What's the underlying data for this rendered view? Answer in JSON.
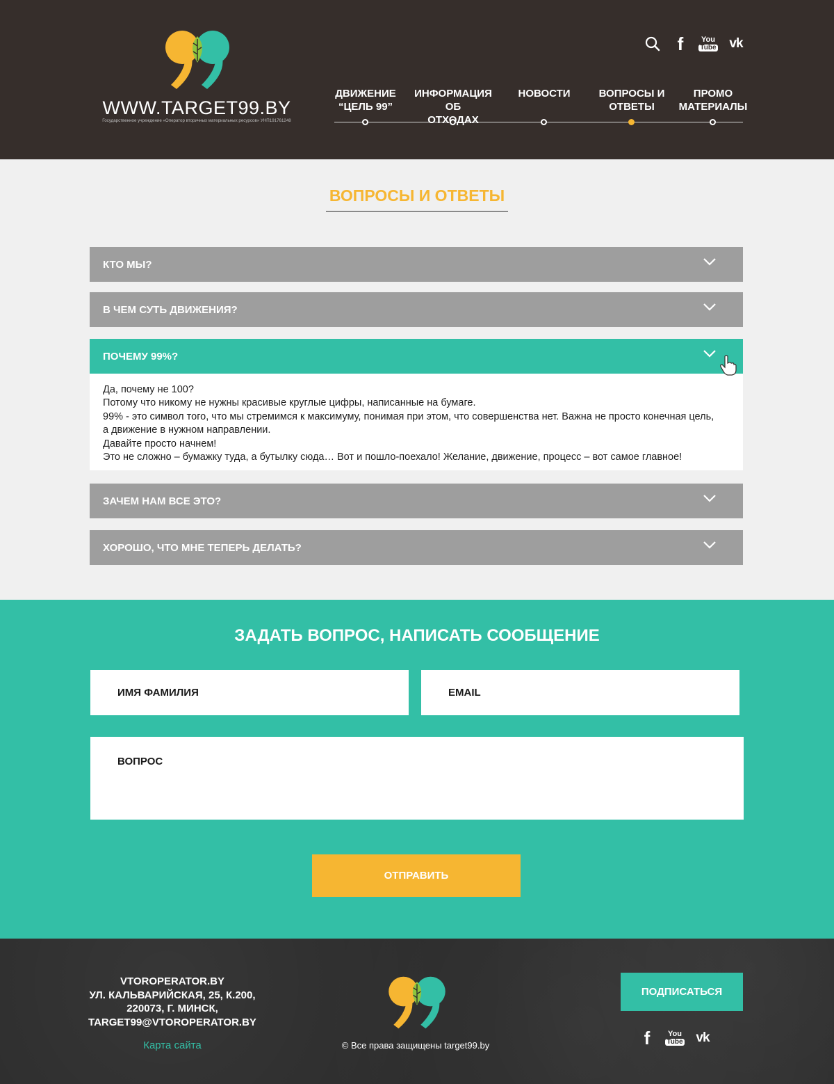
{
  "header": {
    "logo_url": "WWW.TARGET99.BY",
    "logo_sub": "Государственное учреждение «Оператор вторичных материальных ресурсов» УНП191761248",
    "icons": [
      "search-icon",
      "facebook-icon",
      "youtube-icon",
      "vk-icon"
    ],
    "youtube_you": "You",
    "youtube_tube": "Tube",
    "fb_glyph": "f",
    "vk_glyph": "vk",
    "nav": [
      {
        "line1": "ДВИЖЕНИЕ",
        "line2": "“ЦЕЛЬ 99”",
        "active": false
      },
      {
        "line1": "ИНФОРМАЦИЯ ОБ",
        "line2": "ОТХОДАХ",
        "active": false
      },
      {
        "line1": "НОВОСТИ",
        "line2": "",
        "active": false
      },
      {
        "line1": "ВОПРОСЫ И",
        "line2": "ОТВЕТЫ",
        "active": true
      },
      {
        "line1": "ПРОМО",
        "line2": "МАТЕРИАЛЫ",
        "active": false
      }
    ]
  },
  "main": {
    "title": "ВОПРОСЫ И ОТВЕТЫ",
    "faq": [
      {
        "question": "КТО МЫ?",
        "open": false
      },
      {
        "question": "В ЧЕМ СУТЬ ДВИЖЕНИЯ?",
        "open": false
      },
      {
        "question": "ПОЧЕМУ 99%?",
        "open": true
      },
      {
        "question": "ЗАЧЕМ НАМ ВСЕ ЭТО?",
        "open": false
      },
      {
        "question": "ХОРОШО, ЧТО МНЕ ТЕПЕРЬ ДЕЛАТЬ?",
        "open": false
      }
    ],
    "answer_lines": [
      "Да, почему не 100?",
      "Потому что никому не нужны красивые круглые цифры, написанные на бумаге.",
      "99% - это символ того, что мы стремимся к максимуму, понимая при этом, что совершенства нет. Важна не просто конечная цель,",
      "а движение в нужном направлении.",
      "Давайте просто начнем!",
      "Это не сложно – бумажку туда, а бутылку сюда… Вот и пошло-поехало! Желание, движение, процесс – вот самое главное!"
    ]
  },
  "form": {
    "title": "ЗАДАТЬ ВОПРОС, НАПИСАТЬ СООБЩЕНИЕ",
    "name_placeholder": "ИМЯ ФАМИЛИЯ",
    "email_placeholder": "EMAIL",
    "question_placeholder": "ВОПРОС",
    "submit_label": "ОТПРАВИТЬ"
  },
  "footer": {
    "address_lines": [
      "VTOROPERATOR.BY",
      "УЛ. КАЛЬВАРИЙСКАЯ, 25, К.200,",
      "220073, Г. МИНСК,",
      "TARGET99@VTOROPERATOR.BY"
    ],
    "sitemap": "Карта сайта",
    "copyright": "© Все права защищены target99.by",
    "subscribe_label": "ПОДПИСАТЬСЯ"
  },
  "colors": {
    "header_bg": "#362e2b",
    "accent_yellow": "#f6b632",
    "accent_teal": "#33bfa6",
    "faq_gray": "#9e9e9e",
    "page_bg": "#f0f0f0"
  }
}
